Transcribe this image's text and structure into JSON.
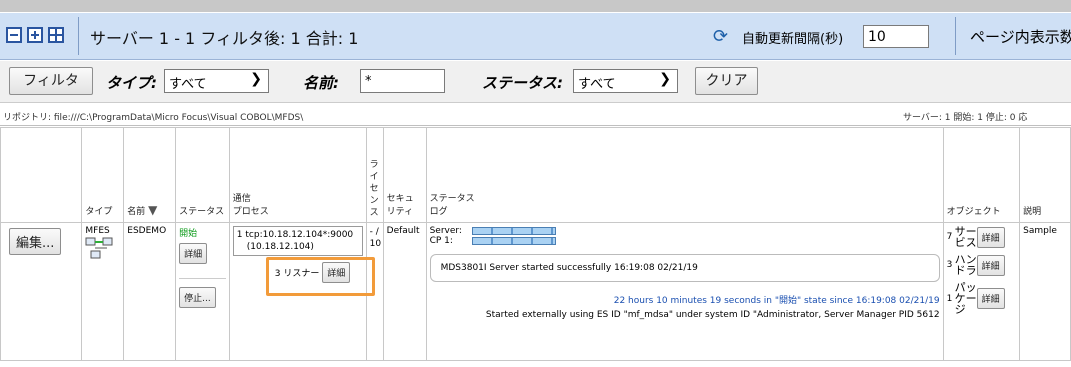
{
  "header": {
    "title": "サーバー 1 - 1 フィルタ後: 1 合計: 1",
    "interval_label": "自動更新間隔(秒)",
    "interval_value": "10",
    "per_page_label": "ページ内表示数"
  },
  "filterbar": {
    "filter_button": "フィルタ",
    "type_label": "タイプ:",
    "type_value": "すべて",
    "name_label": "名前:",
    "name_value": "*",
    "status_label": "ステータス:",
    "status_value": "すべて",
    "clear_button": "クリア"
  },
  "repository": {
    "path": "リポジトリ: file:///C:\\ProgramData\\Micro Focus\\Visual COBOL\\MFDS\\",
    "counts": "サーバー: 1  開始: 1  停止: 0  応"
  },
  "columns": {
    "type": "タイプ",
    "name": "名前",
    "status": "ステータス",
    "process_1": "通信",
    "process_2": "プロセス",
    "license": "ライセンス",
    "security": "セキュリティ",
    "status_log_1": "ステータス",
    "status_log_2": "ログ",
    "objects": "オブジェクト",
    "description": "説明"
  },
  "row": {
    "edit_button": "編集...",
    "type": "MFES",
    "name": "ESDEMO",
    "status": "開始",
    "detail_button": "詳細",
    "stop_button": "停止...",
    "process_index": "1",
    "process_address": "tcp:10.18.12.104*:9000",
    "process_sub": "(10.18.12.104)",
    "listener_text": "3 リスナー",
    "listener_detail": "詳細",
    "license": "- / 10",
    "security": "Default",
    "server_label": "Server:",
    "cp_label": "CP 1:",
    "message": "MDS3801I Server started successfully 16:19:08 02/21/19",
    "uptime": "22 hours 10 minutes 19 seconds in \"開始\" state since 16:19:08 02/21/19",
    "started_by": "Started externally using ES ID \"mf_mdsa\" under system ID \"Administrator, Server Manager PID 5612",
    "objects": [
      {
        "count": "7",
        "name": "サービス",
        "button": "詳細"
      },
      {
        "count": "3",
        "name": "ハンドラ",
        "button": "詳細"
      },
      {
        "count": "1",
        "name": "パッケージ",
        "button": "詳細"
      }
    ],
    "description": "Sample"
  }
}
